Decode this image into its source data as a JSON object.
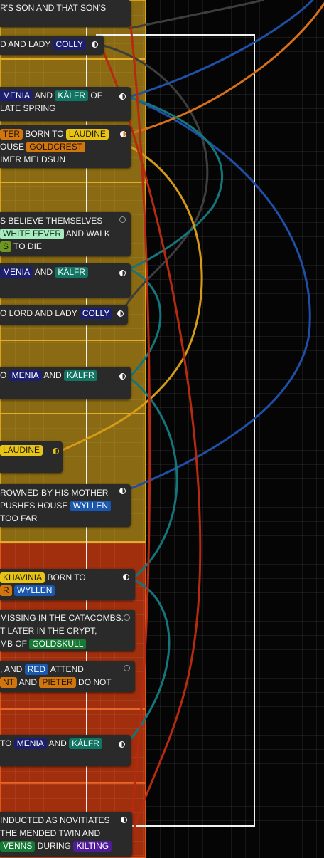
{
  "cards": [
    {
      "id": "card-1",
      "lines": [
        [
          {
            "t": "R'S SON AND THAT SON'S"
          }
        ]
      ],
      "moon": "none"
    },
    {
      "id": "card-2",
      "lines": [
        [
          {
            "t": "D AND LADY "
          },
          {
            "tag": "COLLY",
            "c": "navy"
          }
        ]
      ],
      "moon": "half"
    },
    {
      "id": "card-3",
      "lines": [
        [
          {
            "tag": "MENIA",
            "c": "navy"
          },
          {
            "t": " AND "
          },
          {
            "tag": "KÀLFR",
            "c": "teal"
          },
          {
            "t": " OF"
          }
        ],
        [
          {
            "t": " LATE SPRING"
          }
        ]
      ],
      "moon": "half"
    },
    {
      "id": "card-4",
      "lines": [
        [
          {
            "tag": "TER",
            "c": "orange"
          },
          {
            "t": " BORN TO "
          },
          {
            "tag": "LAUDINE",
            "c": "yellow"
          }
        ],
        [
          {
            "t": "OUSE "
          },
          {
            "tag": "GOLDCREST",
            "c": "orange"
          }
        ],
        [
          {
            "t": "IMER MELDSUN"
          }
        ]
      ],
      "moon": "orange"
    },
    {
      "id": "card-5",
      "lines": [
        [
          {
            "t": "S BELIEVE THEMSELVES"
          }
        ],
        [
          {
            "t": " "
          },
          {
            "tag": "WHITE FEVER",
            "c": "mint"
          },
          {
            "t": " AND WALK"
          }
        ],
        [
          {
            "tag": "S",
            "c": "olive"
          },
          {
            "t": " TO DIE"
          }
        ]
      ],
      "moon": "empty"
    },
    {
      "id": "card-6",
      "lines": [
        [
          {
            "tag": "MENIA",
            "c": "navy"
          },
          {
            "t": " AND "
          },
          {
            "tag": "KÀLFR",
            "c": "teal"
          }
        ]
      ],
      "moon": "half"
    },
    {
      "id": "card-7",
      "lines": [
        [
          {
            "t": "O LORD AND LADY "
          },
          {
            "tag": "COLLY",
            "c": "navy"
          }
        ]
      ],
      "moon": "half"
    },
    {
      "id": "card-8",
      "lines": [
        [
          {
            "t": "O "
          },
          {
            "tag": "MENIA",
            "c": "navy"
          },
          {
            "t": " AND "
          },
          {
            "tag": "KÀLFR",
            "c": "teal"
          }
        ]
      ],
      "moon": "half"
    },
    {
      "id": "card-9",
      "lines": [
        [
          {
            "tag": "LAUDINE",
            "c": "yellow"
          }
        ]
      ],
      "moon": "yellow"
    },
    {
      "id": "card-10",
      "lines": [
        [
          {
            "t": "ROWNED BY HIS MOTHER"
          }
        ],
        [
          {
            "t": "PUSHES HOUSE "
          },
          {
            "tag": "WYLLEN",
            "c": "blue"
          }
        ],
        [
          {
            "t": "TOO FAR"
          }
        ]
      ],
      "moon": "half"
    },
    {
      "id": "card-11",
      "lines": [
        [
          {
            "tag": "KHAVINIA",
            "c": "yellow"
          },
          {
            "t": " BORN TO"
          }
        ],
        [
          {
            "tag": "R",
            "c": "orange"
          },
          {
            "t": " "
          },
          {
            "tag": "WYLLEN",
            "c": "blue"
          }
        ]
      ],
      "moon": "half"
    },
    {
      "id": "card-12",
      "lines": [
        [
          {
            "t": "MISSING IN THE CATACOMBS."
          }
        ],
        [
          {
            "t": "T LATER IN THE CRYPT,"
          }
        ],
        [
          {
            "t": "MB OF "
          },
          {
            "tag": "GOLDSKULL",
            "c": "green"
          }
        ]
      ],
      "moon": "empty"
    },
    {
      "id": "card-13",
      "lines": [
        [
          {
            "t": ", AND "
          },
          {
            "tag": "RED",
            "c": "blue"
          },
          {
            "t": " ATTEND"
          }
        ],
        [
          {
            "tag": "NT",
            "c": "orange"
          },
          {
            "t": " AND "
          },
          {
            "tag": "PIETER",
            "c": "orange"
          },
          {
            "t": " DO NOT"
          }
        ]
      ],
      "moon": "empty"
    },
    {
      "id": "card-14",
      "lines": [
        [
          {
            "t": "TO "
          },
          {
            "tag": "MENIA",
            "c": "navy"
          },
          {
            "t": " AND "
          },
          {
            "tag": "KÀLFR",
            "c": "teal"
          }
        ]
      ],
      "moon": "half"
    },
    {
      "id": "card-15",
      "lines": [
        [
          {
            "t": " INDUCTED AS NOVITIATES"
          }
        ],
        [
          {
            "t": " THE MENDED TWIN AND"
          }
        ],
        [
          {
            "tag": "VENNS",
            "c": "green"
          },
          {
            "t": " DURING "
          },
          {
            "tag": "KILTING",
            "c": "purple"
          }
        ]
      ],
      "moon": "half"
    }
  ],
  "colors": {
    "lane_gold": "#8a6a12",
    "lane_red": "#a12f0d",
    "curve_blue": "#1f4fa6",
    "curve_orange": "#d8701a",
    "curve_teal": "#14767a",
    "curve_gold": "#d49b18",
    "curve_red": "#b52a10",
    "curve_gray": "#3e3e3e"
  }
}
